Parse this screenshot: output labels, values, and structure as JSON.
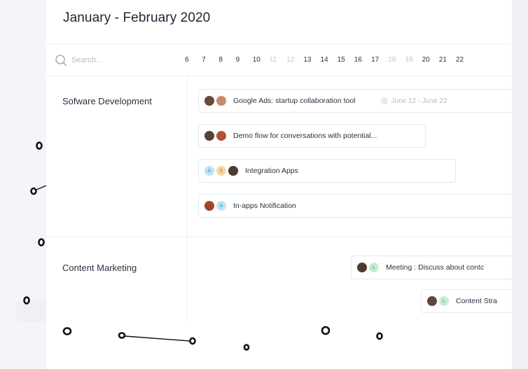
{
  "header": {
    "title": "January - February 2020",
    "search_placeholder": "Search...",
    "days": [
      "6",
      "7",
      "8",
      "9",
      "10",
      "11",
      "12",
      "13",
      "14",
      "15",
      "16",
      "17",
      "18",
      "19",
      "20",
      "21",
      "22"
    ],
    "weekend_days": [
      "11",
      "12",
      "18",
      "19"
    ]
  },
  "groups": [
    {
      "label": "Sofware Development",
      "tasks": [
        {
          "title": "Google Ads: startup collaboration tool",
          "date": "June 12 - June 22",
          "avatars": [
            "photo",
            "photo"
          ]
        },
        {
          "title": "Demo flow for conversations with potential...",
          "avatars": [
            "photo",
            "photo"
          ]
        },
        {
          "title": "Integration Apps",
          "avatars": [
            "A",
            "D",
            "photo"
          ]
        },
        {
          "title": "In-apps Notification",
          "avatars": [
            "photo",
            "A"
          ]
        }
      ]
    },
    {
      "label": "Content Marketing",
      "tasks": [
        {
          "title": "Meeting : Discuss about contc",
          "avatars": [
            "photo",
            "L"
          ]
        },
        {
          "title": "Content Stra",
          "avatars": [
            "photo",
            "L"
          ]
        }
      ]
    }
  ],
  "colors": {
    "accent_blue": "#bfe3f5",
    "accent_orange": "#f9d9a8",
    "accent_green": "#c8ecd3",
    "text": "#1f2433",
    "muted": "#b5bac3"
  }
}
